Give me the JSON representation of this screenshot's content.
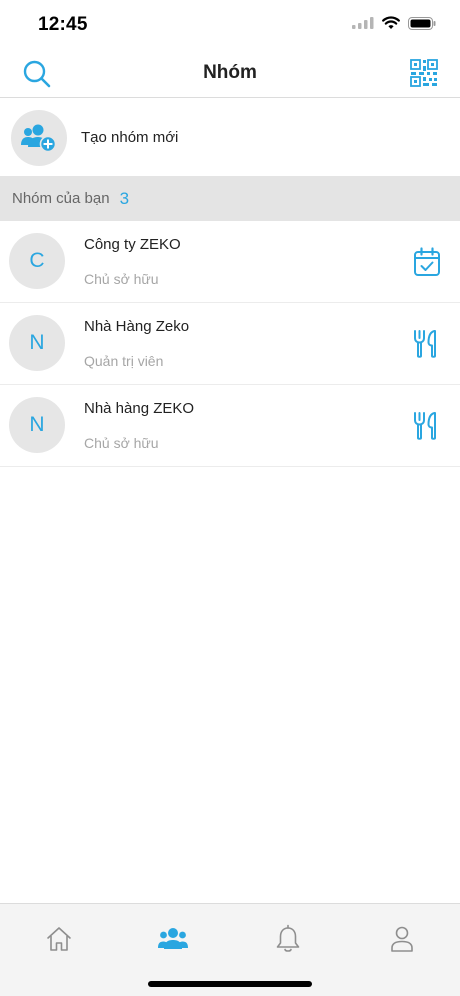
{
  "status_bar": {
    "time": "12:45"
  },
  "header": {
    "title": "Nhóm"
  },
  "create_group": {
    "label": "Tạo nhóm mới"
  },
  "section": {
    "label": "Nhóm của bạn",
    "count": "3"
  },
  "groups": [
    {
      "initial": "C",
      "name": "Công ty ZEKO",
      "role": "Chủ sở hữu",
      "icon": "calendar-check-icon"
    },
    {
      "initial": "N",
      "name": "Nhà Hàng Zeko",
      "role": "Quản trị viên",
      "icon": "restaurant-icon"
    },
    {
      "initial": "N",
      "name": "Nhà hàng ZEKO",
      "role": "Chủ sở hữu",
      "icon": "restaurant-icon"
    }
  ],
  "tab_bar": {
    "active": "groups",
    "tabs": [
      "home-icon",
      "groups-icon",
      "bell-icon",
      "profile-icon"
    ]
  },
  "colors": {
    "accent": "#2aa6e0",
    "avatar_bg": "#e6e6e6",
    "section_bg": "#e4e4e4"
  }
}
